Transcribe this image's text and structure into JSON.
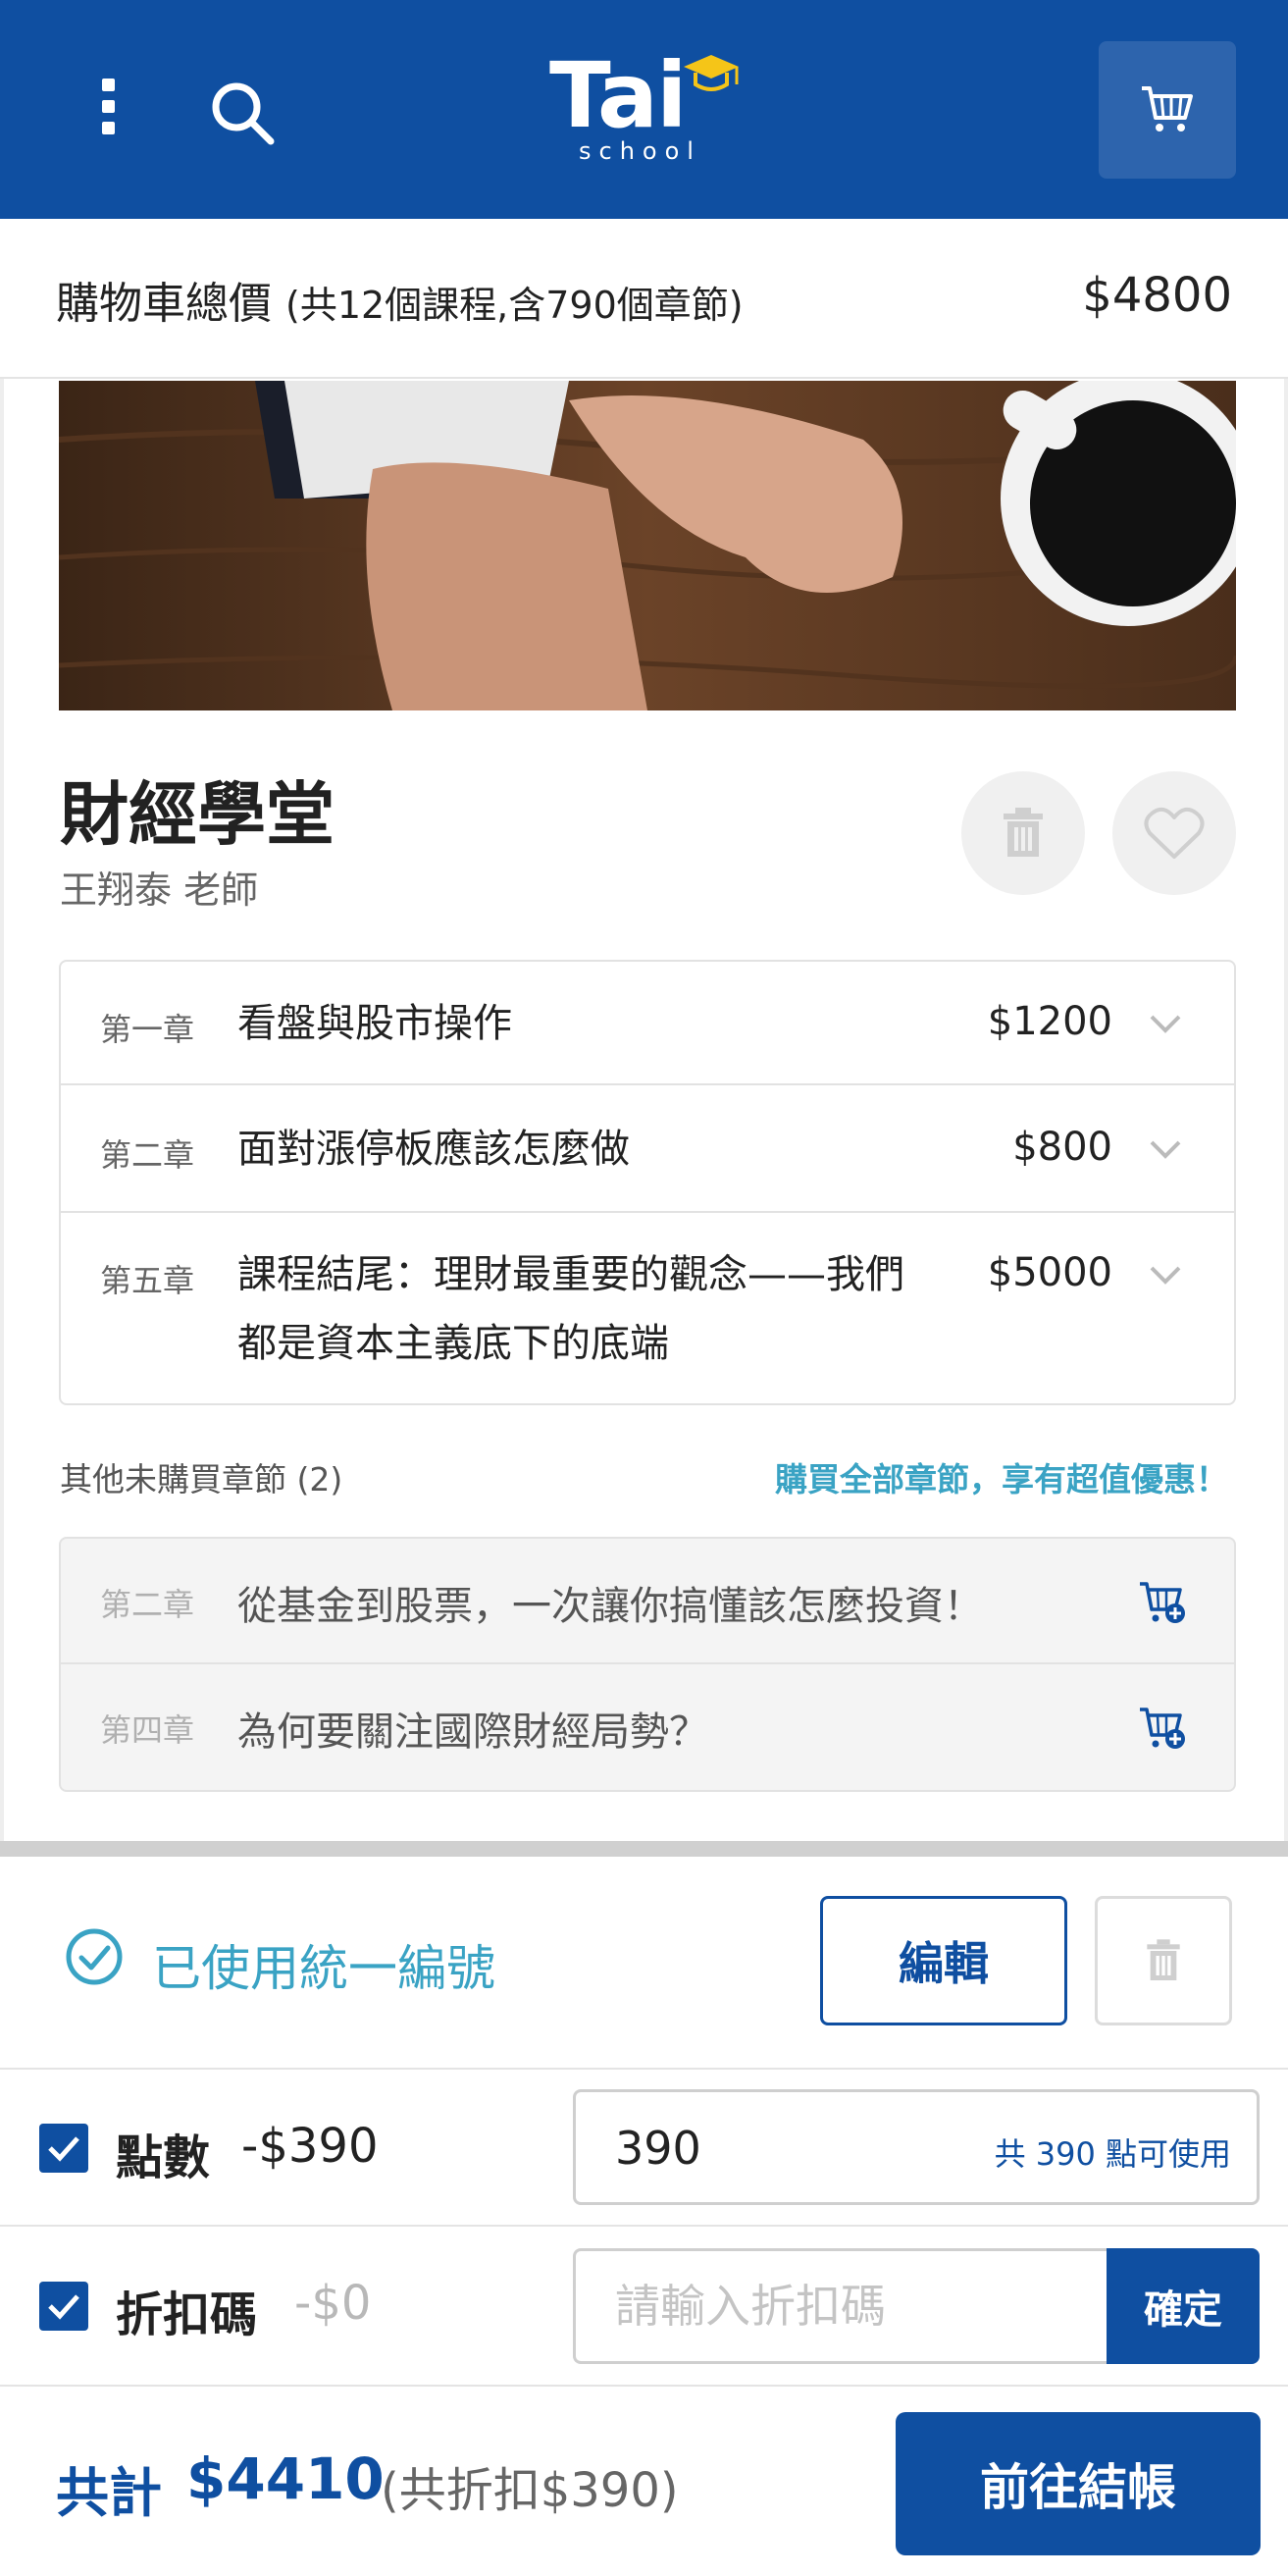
{
  "header": {
    "logo_text": "Tai",
    "logo_subtext": "school",
    "icons": {
      "menu": "more-vert-icon",
      "search": "search-icon",
      "cart": "cart-icon"
    }
  },
  "cart_summary": {
    "label": "購物車總價",
    "detail": "(共12個課程,含790個章節)",
    "total": "$4800"
  },
  "course": {
    "title": "財經學堂",
    "teacher": "王翔泰 老師",
    "chapters": [
      {
        "no": "第一章",
        "title": "看盤與股市操作",
        "price": "$1200"
      },
      {
        "no": "第二章",
        "title": "面對漲停板應該怎麼做",
        "price": "$800"
      },
      {
        "no": "第五章",
        "title": "課程結尾：理財最重要的觀念——我們都是資本主義底下的底端",
        "price": "$5000"
      }
    ],
    "other_label": "其他未購買章節 (2)",
    "other_promo": "購買全部章節，享有超值優惠！",
    "unbought": [
      {
        "no": "第二章",
        "title": "從基金到股票，一次讓你搞懂該怎麼投資！"
      },
      {
        "no": "第四章",
        "title": "為何要關注國際財經局勢？"
      }
    ]
  },
  "tax_id": {
    "label": "已使用統一編號",
    "edit_label": "編輯"
  },
  "points": {
    "label": "點數",
    "amount": "-$390",
    "value": "390",
    "note": "共 390 點可使用"
  },
  "discount": {
    "label": "折扣碼",
    "amount": "-$0",
    "placeholder": "請輸入折扣碼",
    "confirm_label": "確定"
  },
  "footer": {
    "sum_label": "共計",
    "sum_value": "$4410",
    "discount_note": "(共折扣$390)",
    "checkout_label": "前往結帳"
  },
  "colors": {
    "primary": "#0f4fa1",
    "accent": "#3aa3c4"
  }
}
